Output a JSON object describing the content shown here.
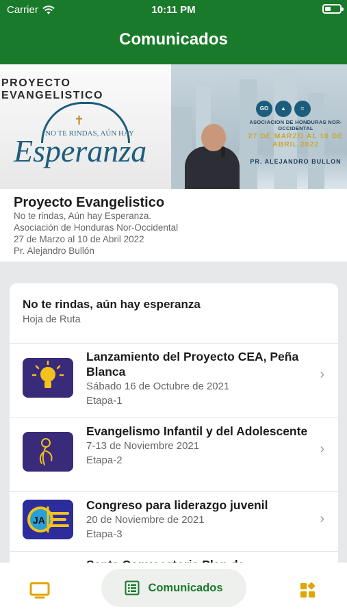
{
  "status": {
    "carrier": "Carrier",
    "time": "10:11 PM"
  },
  "header": {
    "title": "Comunicados"
  },
  "banner": {
    "left_heading": "PROYECTO EVANGELISTICO",
    "left_tagline": "NO TE RINDAS, AÚN HAY",
    "left_word": "Esperanza",
    "right_association": "ASOCIACION DE HONDURAS NOR-OCCIDENTAL",
    "right_date": "27 DE MARZO AL 10 DE ABRIL 2022",
    "right_speaker": "PR. ALEJANDRO BULLON",
    "logos": [
      "GO",
      "",
      ""
    ]
  },
  "info": {
    "title": "Proyecto Evangelistico",
    "lines": [
      "No te rindas, Aún hay Esperanza.",
      "Asociación de Honduras Nor-Occidental",
      "27 de Marzo al 10 de Abril 2022",
      "Pr. Alejandro Bullón"
    ]
  },
  "card": {
    "title": "No te rindas, aún hay esperanza",
    "subtitle": "Hoja de Ruta",
    "items": [
      {
        "title": "Lanzamiento del Proyecto CEA, Peña Blanca",
        "date": "Sábado  16 de Octubre de 2021",
        "stage": "Etapa-1",
        "icon": "lightbulb-icon"
      },
      {
        "title": "Evangelismo Infantil y del Adolescente",
        "date": "7-13 de Noviembre 2021",
        "stage": "Etapa-2",
        "icon": "child-drawing-icon"
      },
      {
        "title": "Congreso para liderazgo juvenil",
        "date": "20 de Noviembre de 2021",
        "stage": "Etapa-3",
        "icon": "ja-logo-icon"
      },
      {
        "title": "Santa Convocatoria Plan de",
        "date": "",
        "stage": "",
        "icon": ""
      }
    ]
  },
  "tabbar": {
    "center_label": "Comunicados",
    "left_icon": "tv-icon",
    "center_icon": "list-icon",
    "right_icon": "widgets-icon"
  },
  "colors": {
    "header": "#1a7a2b",
    "accent_icon": "#e0a500",
    "row_icon_bg": "#3a2a7a"
  }
}
